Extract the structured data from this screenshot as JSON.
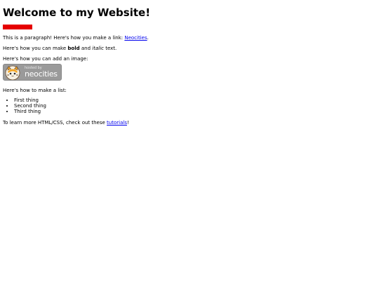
{
  "heading": "Welcome to my Website!",
  "paragraph": {
    "before": "This is a paragraph! Here's how you make a link: ",
    "link": "Neocities",
    "after": "."
  },
  "formatting": {
    "before": "Here's how you can make ",
    "bold": "bold",
    "middle": " and ",
    "italic": "italic",
    "after": " text."
  },
  "image_intro": "Here's how you can add an image:",
  "badge": {
    "hosted": "hosted by",
    "brand": "neocities",
    "icon": "neocities-cat-icon"
  },
  "list_intro": "Here's how to make a list:",
  "list_items": [
    "First thing",
    "Second thing",
    "Third thing"
  ],
  "learn_more": {
    "before": "To learn more HTML/CSS, check out these ",
    "link": "tutorials",
    "after": "!"
  },
  "colors": {
    "red_bar": "#e50000",
    "link": "#0000ee"
  }
}
